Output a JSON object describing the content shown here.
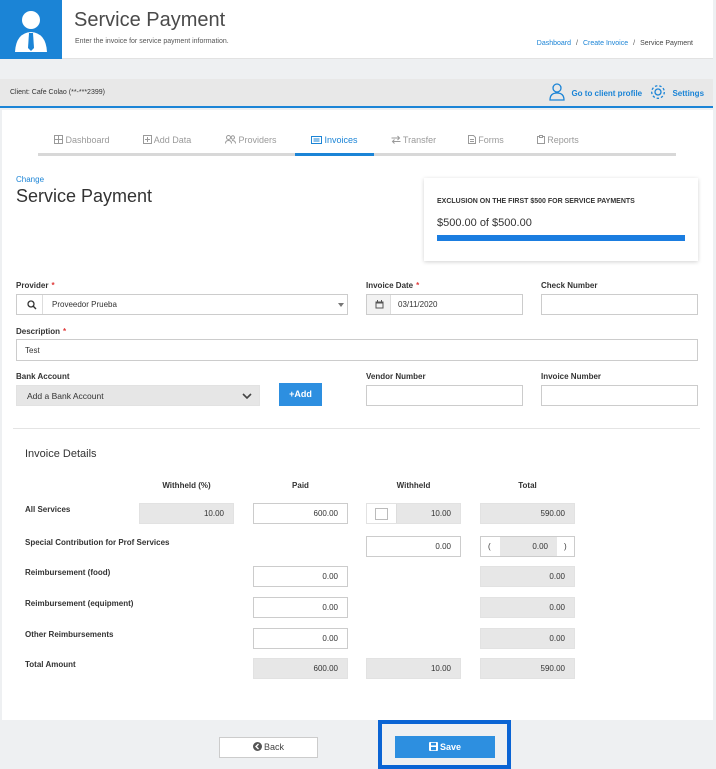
{
  "header": {
    "title": "Service Payment",
    "subtitle": "Enter the invoice for service payment information.",
    "breadcrumbs": [
      "Dashboard",
      "Create Invoice",
      "Service Payment"
    ],
    "breadcrumb_sep": "/"
  },
  "client_bar": {
    "label": "Client:",
    "client": "Cafe Colao (**-***2399)",
    "profile_link": "Go to client profile",
    "settings_link": "Settings"
  },
  "tabs": [
    {
      "label": "Dashboard",
      "icon": "grid-icon"
    },
    {
      "label": "Add Data",
      "icon": "plus-square-icon"
    },
    {
      "label": "Providers",
      "icon": "users-icon"
    },
    {
      "label": "Invoices",
      "icon": "invoice-icon",
      "active": true
    },
    {
      "label": "Transfer",
      "icon": "transfer-icon"
    },
    {
      "label": "Forms",
      "icon": "file-icon"
    },
    {
      "label": "Reports",
      "icon": "clipboard-icon"
    }
  ],
  "form": {
    "change_link": "Change",
    "title": "Service Payment",
    "exclusion": {
      "title": "EXCLUSION ON THE FIRST $500 FOR SERVICE PAYMENTS",
      "amount_text": "$500.00 of $500.00",
      "progress": 1.0
    },
    "provider": {
      "label": "Provider",
      "required": "*",
      "value": "Proveedor Prueba"
    },
    "invoice_date": {
      "label": "Invoice Date",
      "required": "*",
      "value": "03/11/2020"
    },
    "check_number": {
      "label": "Check Number",
      "value": ""
    },
    "description": {
      "label": "Description",
      "required": "*",
      "value": "Test"
    },
    "bank_account": {
      "label": "Bank Account",
      "value": "Add a Bank Account",
      "add_label": "Add",
      "add_prefix": "+"
    },
    "vendor_number": {
      "label": "Vendor Number",
      "value": ""
    },
    "invoice_number": {
      "label": "Invoice Number",
      "value": ""
    }
  },
  "details": {
    "title": "Invoice Details",
    "columns": [
      "Withheld (%)",
      "Paid",
      "Withheld",
      "Total"
    ],
    "rows": {
      "all_services": {
        "label": "All Services",
        "withheld_pct": "10.00",
        "paid": "600.00",
        "withheld": "10.00",
        "total": "590.00"
      },
      "special": {
        "label": "Special Contribution for Prof Services",
        "withheld": "0.00",
        "total_open": "(",
        "total": "0.00",
        "total_close": ")"
      },
      "food": {
        "label": "Reimbursement (food)",
        "paid": "0.00",
        "total": "0.00"
      },
      "equipment": {
        "label": "Reimbursement (equipment)",
        "paid": "0.00",
        "total": "0.00"
      },
      "other": {
        "label": "Other Reimbursements",
        "paid": "0.00",
        "total": "0.00"
      },
      "total_amount": {
        "label": "Total Amount",
        "paid": "600.00",
        "withheld": "10.00",
        "total": "590.00"
      }
    }
  },
  "footer": {
    "back_label": "Back",
    "save_label": "Save"
  },
  "colors": {
    "accent": "#1b84d6",
    "required": "#e03b3b",
    "highlight": "#0a64d4"
  }
}
